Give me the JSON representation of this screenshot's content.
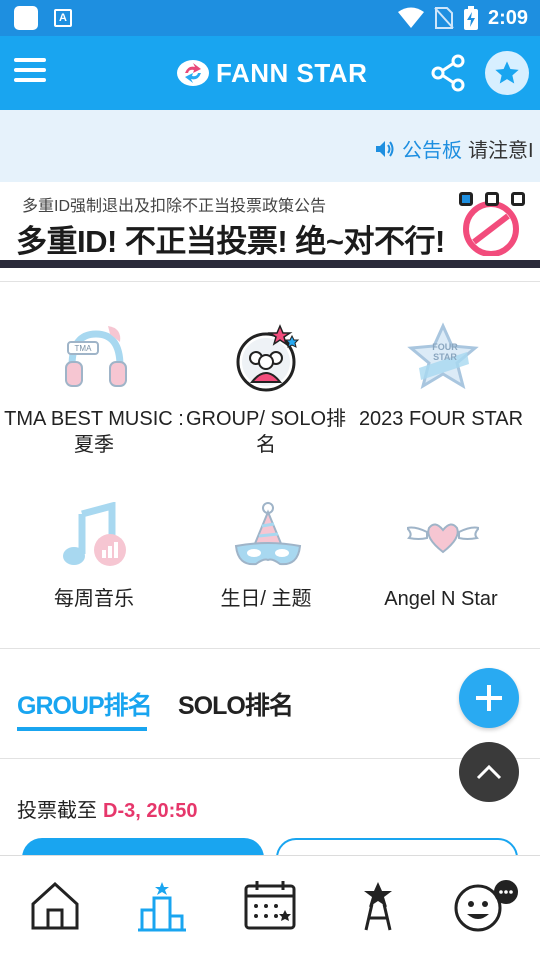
{
  "status_bar": {
    "time": "2:09",
    "icons": [
      "app-notification-icon",
      "keyboard-a-icon",
      "wifi-icon",
      "no-sim-icon",
      "battery-charging-icon"
    ]
  },
  "app_bar": {
    "logo_text": "FANN STAR",
    "icons": [
      "menu-icon",
      "share-icon",
      "star-icon"
    ]
  },
  "notice": {
    "label": "公告板",
    "text": "请注意I"
  },
  "banner": {
    "subtitle": "多重ID强制退出及扣除不正当投票政策公告",
    "title": "多重ID! 不正当投票! 绝~对不行!",
    "page_count": 3,
    "active_page": 1
  },
  "categories": [
    {
      "label": "TMA BEST MUSIC : 夏季",
      "icon": "headphones-icon"
    },
    {
      "label": "GROUP/ SOLO排名",
      "icon": "group-ranking-icon"
    },
    {
      "label": "2023 FOUR STAR",
      "icon": "four-star-icon"
    },
    {
      "label": "每周音乐",
      "icon": "music-note-icon"
    },
    {
      "label": "生日/ 主题",
      "icon": "party-mask-icon"
    },
    {
      "label": "Angel N Star",
      "icon": "winged-heart-icon"
    }
  ],
  "ranking_tabs": {
    "group": "GROUP排名",
    "solo": "SOLO排名",
    "active": "group"
  },
  "deadline": {
    "label": "投票截至",
    "value": "D-3, 20:50"
  },
  "bottom_nav": [
    "home-icon",
    "ranking-chart-icon",
    "calendar-icon",
    "star-stand-icon",
    "smiley-chat-icon"
  ],
  "colors": {
    "primary": "#19a5f0",
    "status_bar": "#1e8fe0",
    "deadline_accent": "#e6376b",
    "notice_bg": "#e6f2fb"
  }
}
